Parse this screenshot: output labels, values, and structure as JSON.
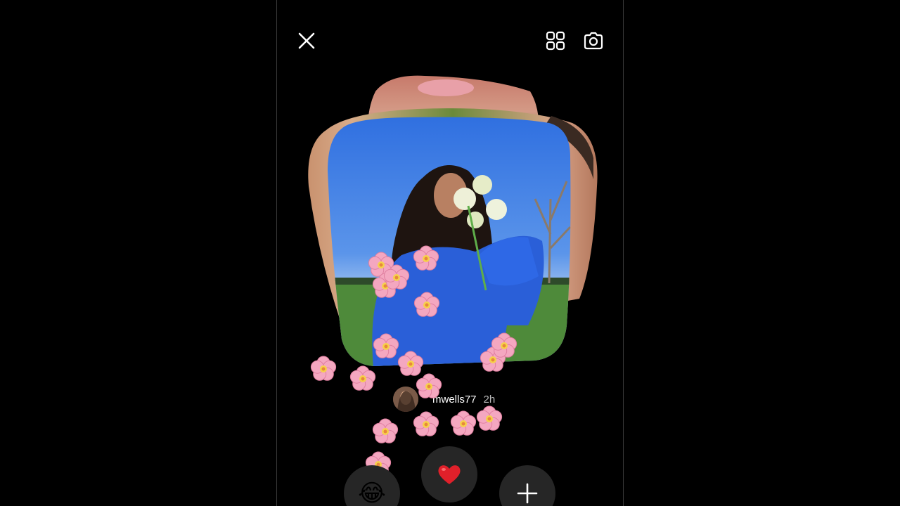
{
  "header": {
    "close_icon": "close-icon",
    "grid_icon": "grid-icon",
    "camera_icon": "camera-icon"
  },
  "post": {
    "username": "mwells77",
    "time_ago": "2h"
  },
  "reactions": {
    "laugh": "😂",
    "heart": "❤️",
    "add_icon": "plus-icon"
  },
  "colors": {
    "background": "#000000",
    "button_bg": "#262626",
    "heart": "#e0202a",
    "flower": "#f4a7c0"
  }
}
